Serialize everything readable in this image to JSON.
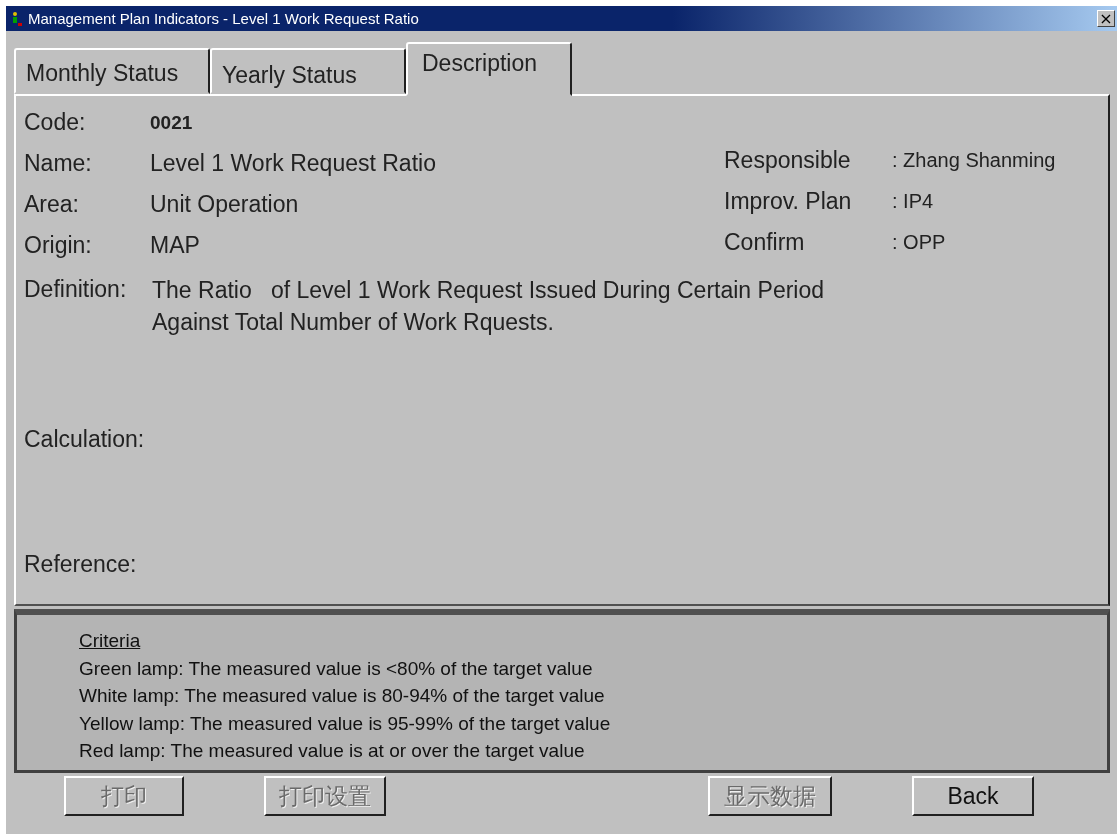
{
  "window": {
    "title": "Management Plan Indicators - Level 1 Work Request Ratio",
    "close": "×"
  },
  "tabs": [
    {
      "label": "Monthly Status",
      "selected": false
    },
    {
      "label": "Yearly Status",
      "selected": false
    },
    {
      "label": "Description",
      "selected": true
    }
  ],
  "fields_left": [
    {
      "label": "Code:",
      "value": "0021",
      "bold": true
    },
    {
      "label": "Name:",
      "value": "Level 1 Work Request Ratio",
      "bold": false
    },
    {
      "label": "Area:",
      "value": "Unit Operation",
      "bold": false
    },
    {
      "label": "Origin:",
      "value": "MAP",
      "bold": false
    }
  ],
  "fields_right": [
    {
      "label": "Responsible",
      "value": ": Zhang Shanming"
    },
    {
      "label": "Improv. Plan",
      "value": ": IP4"
    },
    {
      "label": "Confirm",
      "value": ": OPP"
    }
  ],
  "definition": {
    "label": "Definition:",
    "value": "The Ratio   of Level 1 Work Request Issued During Certain Period Against Total Number of Work Rquests."
  },
  "calculation": {
    "label": "Calculation:"
  },
  "reference": {
    "label": "Reference:"
  },
  "criteria": {
    "title": "Criteria",
    "lines": [
      "Green lamp: The measured value is <80% of the target value",
      "White lamp: The measured value is 80-94% of the target value",
      "Yellow lamp: The measured value is 95-99% of the target value",
      "Red lamp: The measured value is at or over the target value"
    ]
  },
  "buttons": [
    {
      "label": "打印",
      "disabled": true
    },
    {
      "label": "打印设置",
      "disabled": true
    },
    {
      "label": "显示数据",
      "disabled": true
    },
    {
      "label": "Back",
      "disabled": false
    }
  ]
}
